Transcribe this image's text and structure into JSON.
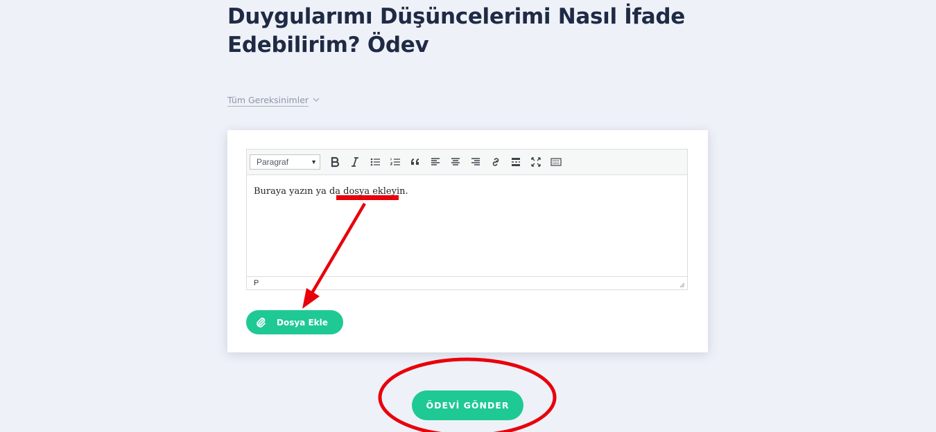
{
  "page": {
    "title": "Duygularımı Düşüncelerimi Nasıl İfade Edebilirim? Ödev"
  },
  "requirements": {
    "label": "Tüm Gereksinimler",
    "icon": "chevron-down-icon"
  },
  "editor": {
    "format_selected": "Paragraf",
    "toolbar_icons": [
      "bold-icon",
      "italic-icon",
      "bullet-list-icon",
      "numbered-list-icon",
      "blockquote-icon",
      "align-left-icon",
      "align-center-icon",
      "align-right-icon",
      "link-icon",
      "read-more-icon",
      "fullscreen-icon",
      "toolbar-toggle-icon"
    ],
    "placeholder_text": "Buraya yazın ya da dosya ekleyin.",
    "status_path": "P"
  },
  "attach": {
    "label": "Dosya Ekle",
    "icon": "paperclip-icon"
  },
  "submit": {
    "label": "ÖDEVİ GÖNDER"
  },
  "colors": {
    "accent": "#1fc993",
    "background": "#eef1f8",
    "title": "#1f2a44",
    "annotation": "#e8000b"
  }
}
